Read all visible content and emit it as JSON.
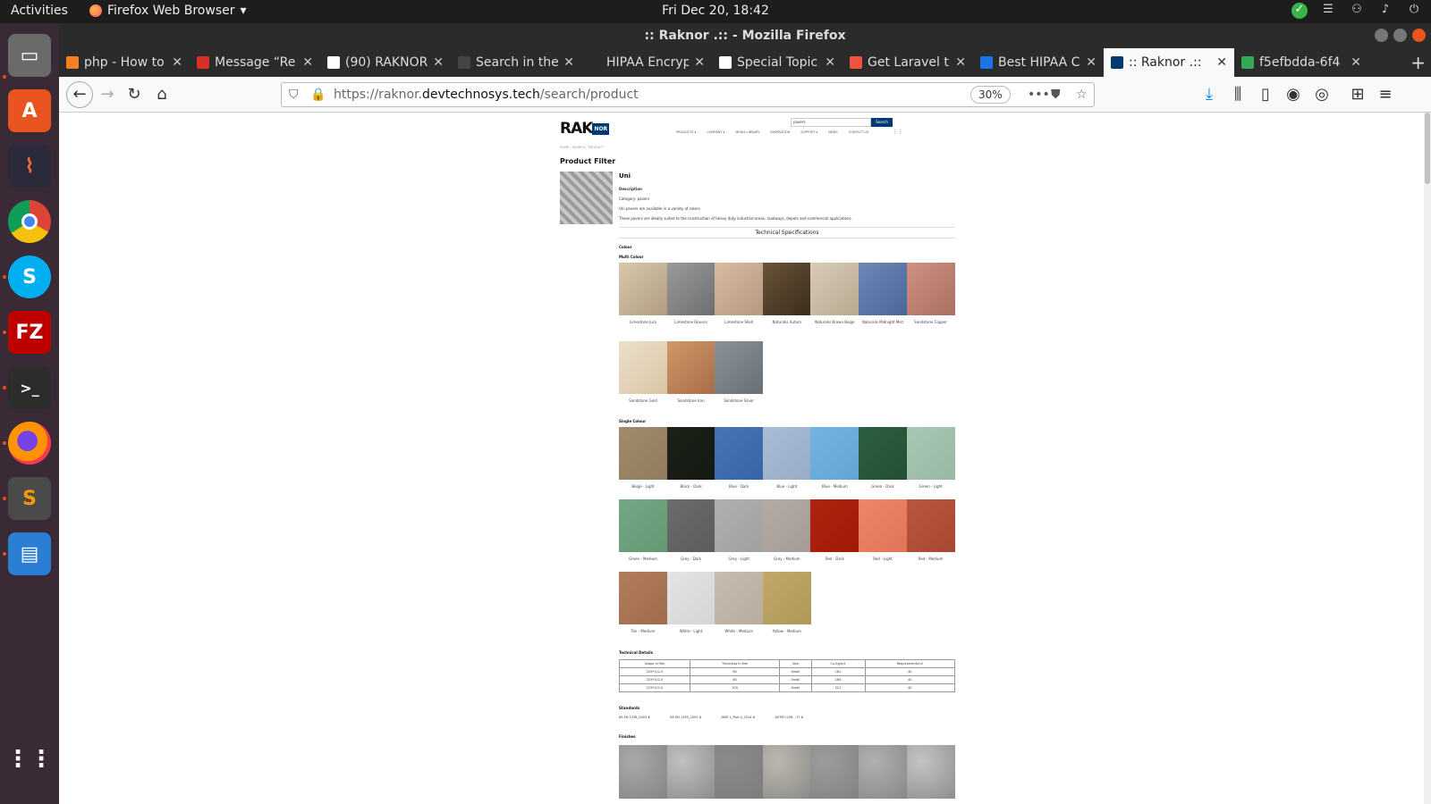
{
  "topbar": {
    "activities": "Activities",
    "app": "Firefox Web Browser",
    "clock": "Fri Dec 20, 18:42"
  },
  "window": {
    "title": ":: Raknor .:: - Mozilla Firefox"
  },
  "tabs": [
    {
      "label": "php - How to",
      "color": "#f48024"
    },
    {
      "label": "Message “Re",
      "color": "#d93025"
    },
    {
      "label": "(90) RAKNOR",
      "color": "#ffffff"
    },
    {
      "label": "Search in the",
      "color": "#444444"
    },
    {
      "label": "HIPAA Encryptio",
      "color": "#2b2b2b"
    },
    {
      "label": "Special Topic",
      "color": "#ffffff"
    },
    {
      "label": "Get Laravel tr",
      "color": "#f05340"
    },
    {
      "label": "Best HIPAA C",
      "color": "#1a73e8"
    },
    {
      "label": ":: Raknor .::",
      "color": "#003a70"
    },
    {
      "label": "f5efbdda-6f4",
      "color": "#34a853"
    }
  ],
  "nav": {
    "url_prefix": "https://raknor.",
    "url_domain": "devtechnosys.tech",
    "url_path": "/search/product",
    "zoom": "30%"
  },
  "site": {
    "logo_main": "RAK",
    "logo_tag": "NOR",
    "search_value": "pavers",
    "search_button": "Search",
    "menu": [
      "PRODUCTS ▾",
      "COMPANY ▾",
      "MEDIA LIBRARY",
      "INSPIRATION",
      "SUPPORT ▾",
      "NEWS",
      "CONTACT US"
    ],
    "breadcrumb": "HOME  /  SEARCH  /  PRODUCT",
    "filter_title": "Product Filter",
    "product_name": "Uni",
    "desc_heading": "Description",
    "category": "Category: pavers",
    "desc1": "Uni pavers are available in a variety of colors.",
    "desc2": "These pavers are ideally suited to the construction of heavy duty industrial areas, roadways, depots and commercial applications.",
    "tech_specs": "Technical Specifications",
    "colour": "Colour",
    "multi_colour": "Multi Colour",
    "single_colour": "Single Colour",
    "tech_details": "Technical Details",
    "standards_title": "Standards",
    "finishes": "Finishes",
    "multi": [
      {
        "name": "Limestone Jura",
        "c1": "#d8c8a8",
        "c2": "#b09c80"
      },
      {
        "name": "Limestone Dovecs",
        "c1": "#9a9a9a",
        "c2": "#6e6e6e"
      },
      {
        "name": "Limestone Shell",
        "c1": "#d8bca0",
        "c2": "#b49880"
      },
      {
        "name": "Naturalis Autum",
        "c1": "#6a5438",
        "c2": "#3a2c1c"
      },
      {
        "name": "Naturalis Brown Beige",
        "c1": "#d8ccb8",
        "c2": "#b8a890"
      },
      {
        "name": "Naturalis Midnight Mist",
        "c1": "#6c88b8",
        "c2": "#4c6898"
      },
      {
        "name": "Sandstone Copper",
        "c1": "#d09080",
        "c2": "#a87060"
      },
      {
        "name": "Sandstone Gold",
        "c1": "#ece0cc",
        "c2": "#d8c4a4"
      },
      {
        "name": "Sandstone Iron",
        "c1": "#d09868",
        "c2": "#a86c48"
      },
      {
        "name": "Sandstone Silver",
        "c1": "#8a9098",
        "c2": "#6a7078"
      }
    ],
    "single": [
      {
        "name": "Beige - Light",
        "c1": "#a08c6c",
        "c2": "#907c5c"
      },
      {
        "name": "Black - Dark",
        "c1": "#1c2218",
        "c2": "#141a12"
      },
      {
        "name": "Blue - Dark",
        "c1": "#4874b8",
        "c2": "#3864a8"
      },
      {
        "name": "Blue - Light",
        "c1": "#a8bcd8",
        "c2": "#98acc8"
      },
      {
        "name": "Blue - Medium",
        "c1": "#74b4e4",
        "c2": "#64a4d4"
      },
      {
        "name": "Green - Dark",
        "c1": "#2c6040",
        "c2": "#245034"
      },
      {
        "name": "Green - Light",
        "c1": "#a8c8b4",
        "c2": "#98b8a4"
      },
      {
        "name": "Green - Medium",
        "c1": "#74a884",
        "c2": "#649874"
      },
      {
        "name": "Grey - Dark",
        "c1": "#6c6c6c",
        "c2": "#5c5c5c"
      },
      {
        "name": "Grey - Light",
        "c1": "#b0b0b0",
        "c2": "#a0a0a0"
      },
      {
        "name": "Grey - Medium",
        "c1": "#b4aca4",
        "c2": "#a49c94"
      },
      {
        "name": "Red - Dark",
        "c1": "#b02410",
        "c2": "#a01a08"
      },
      {
        "name": "Red - Light",
        "c1": "#f08468",
        "c2": "#e07458"
      },
      {
        "name": "Red - Medium",
        "c1": "#b85840",
        "c2": "#a84830"
      },
      {
        "name": "Tan - Medium",
        "c1": "#b07c5c",
        "c2": "#a06c4c"
      },
      {
        "name": "White - Light",
        "c1": "#e4e4e4",
        "c2": "#d4d4d4"
      },
      {
        "name": "White - Medium",
        "c1": "#c8bcb0",
        "c2": "#b8aca0"
      },
      {
        "name": "Yellow - Medium",
        "c1": "#c0a868",
        "c2": "#b09858"
      }
    ],
    "table": {
      "headers": [
        "Shape In Mm",
        "Thickness In Mm",
        "Size",
        "Cu.Kg/m2",
        "Requirement/m2"
      ],
      "rows": [
        [
          "225*112.5",
          "60",
          "Small",
          "181",
          "40"
        ],
        [
          "225*112.5",
          "80",
          "Small",
          "184",
          "40"
        ],
        [
          "225*112.5",
          "100",
          "Small",
          "221",
          "40"
        ]
      ]
    },
    "standards": [
      "BS EN 1338_2003",
      "BS EN 1339_2003",
      "DMS 1_Part 4_2014",
      "ASTM C158 - 17"
    ]
  }
}
